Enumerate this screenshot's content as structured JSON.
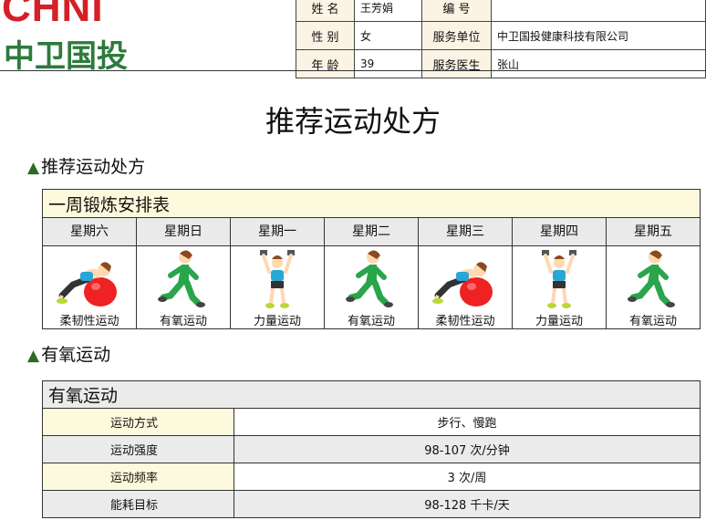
{
  "logo": {
    "latin": "CHNI",
    "cn": "中卫国投"
  },
  "info": {
    "row0": {
      "k1": "姓 名",
      "v1": "王芳娟",
      "k2": "编 号",
      "v2": ""
    },
    "row1": {
      "k1": "性 别",
      "v1": "女",
      "k2": "服务单位",
      "v2": "中卫国投健康科技有限公司"
    },
    "row2": {
      "k1": "年 龄",
      "v1": "39",
      "k2": "服务医生",
      "v2": "张山"
    }
  },
  "title": "推荐运动处方",
  "section1": {
    "marker": "▲",
    "label": "推荐运动处方"
  },
  "week": {
    "caption": "一周锻炼安排表",
    "days": [
      "星期六",
      "星期日",
      "星期一",
      "星期二",
      "星期三",
      "星期四",
      "星期五"
    ],
    "activities": [
      "柔韧性运动",
      "有氧运动",
      "力量运动",
      "有氧运动",
      "柔韧性运动",
      "力量运动",
      "有氧运动"
    ],
    "icons": [
      "ball-stretch-icon",
      "runner-icon",
      "dumbbell-icon",
      "runner-icon",
      "ball-stretch-icon",
      "dumbbell-icon",
      "runner-icon"
    ]
  },
  "section2": {
    "marker": "▲",
    "label": "有氧运动"
  },
  "aerobic": {
    "caption": "有氧运动",
    "rows": [
      {
        "k": "运动方式",
        "v": "步行、慢跑"
      },
      {
        "k": "运动强度",
        "v": "98-107 次/分钟"
      },
      {
        "k": "运动频率",
        "v": "3 次/周"
      },
      {
        "k": "能耗目标",
        "v": "98-128 千卡/天"
      }
    ]
  },
  "colors": {
    "brand_red": "#d42027",
    "brand_green": "#2d7a3d",
    "label_bg": "#fdf9dc",
    "alt_bg": "#ebebeb"
  }
}
